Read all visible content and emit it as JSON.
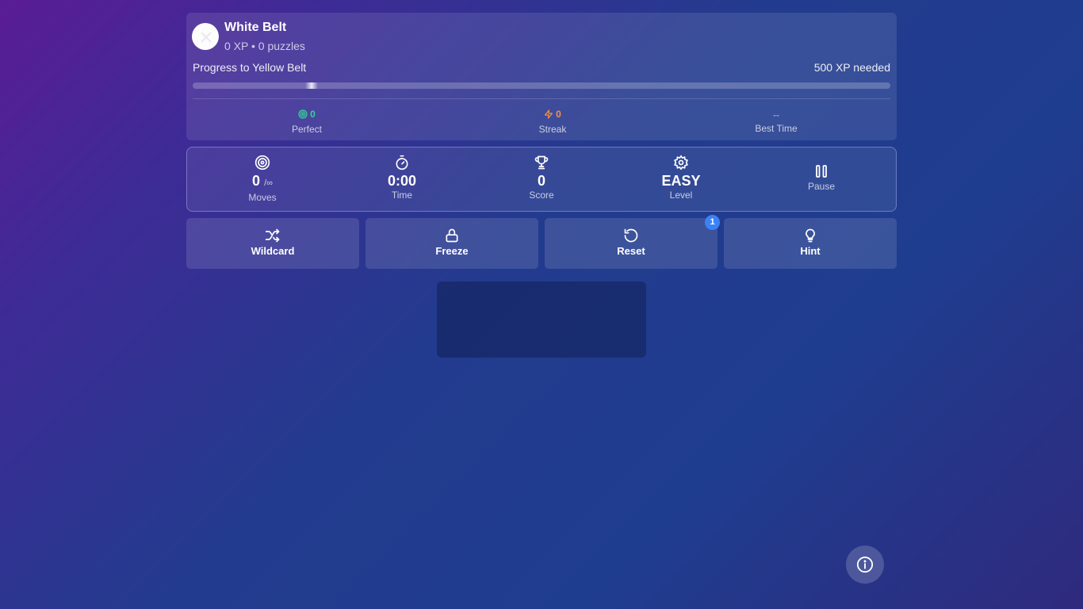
{
  "profile": {
    "belt_title": "White Belt",
    "subtitle": "0 XP • 0 puzzles",
    "progress_label": "Progress to Yellow Belt",
    "progress_needed": "500 XP needed",
    "progress_fraction": 0
  },
  "mini_stats": {
    "perfect": {
      "value": "0",
      "label": "Perfect",
      "icon": "target-icon",
      "color": "#34d399"
    },
    "streak": {
      "value": "0",
      "label": "Streak",
      "icon": "lightning-icon",
      "color": "#fb923c"
    },
    "best_time": {
      "value": "--",
      "label": "Best Time",
      "color": "#60a5fa"
    }
  },
  "stats": {
    "moves": {
      "value": "0",
      "limit": "/∞",
      "label": "Moves",
      "icon": "target-icon"
    },
    "time": {
      "value": "0:00",
      "label": "Time",
      "icon": "stopwatch-icon"
    },
    "score": {
      "value": "0",
      "label": "Score",
      "icon": "trophy-icon"
    },
    "level": {
      "value": "EASY",
      "label": "Level",
      "icon": "gear-icon"
    },
    "pause": {
      "label": "Pause",
      "icon": "pause-icon"
    }
  },
  "actions": {
    "wildcard": {
      "label": "Wildcard",
      "icon": "shuffle-icon"
    },
    "freeze": {
      "label": "Freeze",
      "icon": "lock-icon"
    },
    "reset": {
      "label": "Reset",
      "icon": "reset-icon",
      "badge": "1"
    },
    "hint": {
      "label": "Hint",
      "icon": "lightbulb-icon"
    }
  },
  "info_button": {
    "icon": "info-icon"
  }
}
